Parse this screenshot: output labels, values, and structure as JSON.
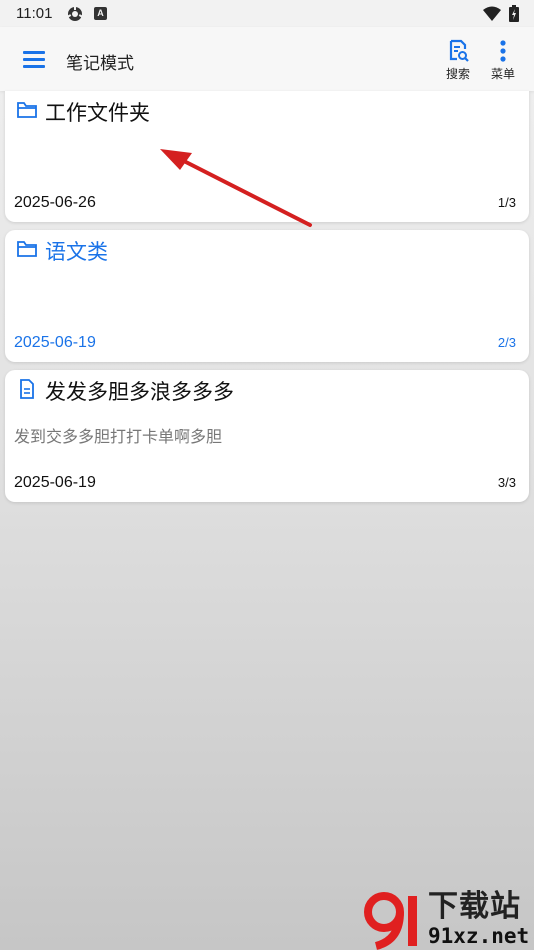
{
  "status_bar": {
    "time": "11:01",
    "b_icon": "A"
  },
  "app_bar": {
    "title": "笔记模式",
    "search_label": "搜索",
    "menu_label": "菜单"
  },
  "notes": [
    {
      "type": "folder",
      "title": "工作文件夹",
      "snippet": "",
      "date": "2025-06-26",
      "page": "1/3",
      "highlight": false
    },
    {
      "type": "folder",
      "title": "语文类",
      "snippet": "",
      "date": "2025-06-19",
      "page": "2/3",
      "highlight": true
    },
    {
      "type": "document",
      "title": "发发多胆多浪多多多",
      "snippet": "发到交多多胆打打卡单啊多胆",
      "date": "2025-06-19",
      "page": "3/3",
      "highlight": false
    }
  ],
  "watermark": {
    "name": "下载站",
    "url": "91xz.net"
  },
  "colors": {
    "accent": "#1a73e8",
    "arrow": "#d42020",
    "watermark_red": "#e02020"
  },
  "icons": [
    "menu-icon",
    "search-doc-icon",
    "more-vert-icon",
    "folder-icon",
    "document-icon"
  ]
}
